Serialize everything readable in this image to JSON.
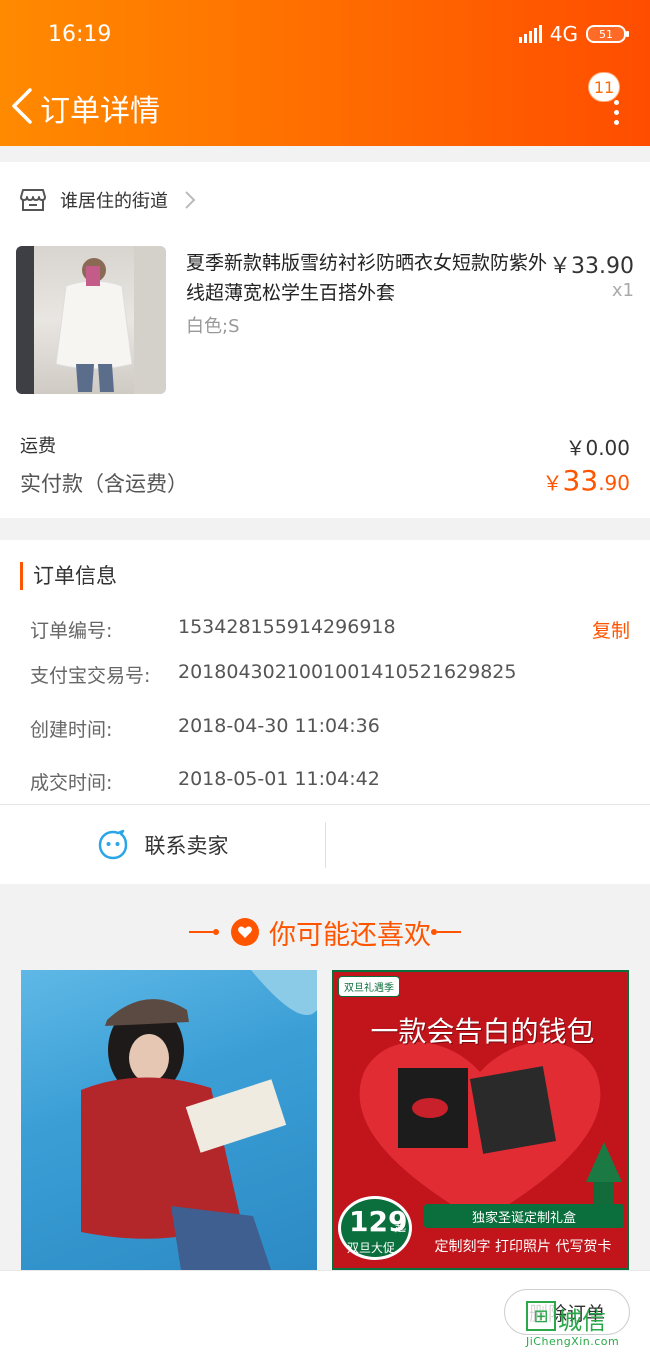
{
  "status_bar": {
    "time": "16:19",
    "network": "4G",
    "battery": "51"
  },
  "nav": {
    "title": "订单详情",
    "badge_count": "11"
  },
  "shop": {
    "name": "谁居住的街道",
    "product": {
      "title": "夏季新款韩版雪纺衬衫防晒衣女短款防紫外线超薄宽松学生百搭外套",
      "sku": "白色;S",
      "price": "￥33.90",
      "quantity": "x1"
    },
    "shipping_label": "运费",
    "shipping_value": "￥0.00",
    "paid_label": "实付款（含运费）",
    "paid_currency": "￥",
    "paid_integer": "33",
    "paid_decimal": ".90"
  },
  "order_info": {
    "title": "订单信息",
    "rows": [
      {
        "label": "订单编号:",
        "value": "153428155914296918"
      },
      {
        "label": "支付宝交易号:",
        "value": "2018043021001001410521629825"
      },
      {
        "label": "创建时间:",
        "value": "2018-04-30 11:04:36"
      },
      {
        "label": "成交时间:",
        "value": "2018-05-01 11:04:42"
      }
    ],
    "copy_label": "复制",
    "contact_label": "联系卖家"
  },
  "recommend": {
    "title": "你可能还喜欢",
    "item2": {
      "tag": "双旦礼遇季",
      "headline": "一款会告白的钱包",
      "price": "129",
      "price_suffix": "起",
      "price_label": "双旦大促",
      "banner": "独家圣诞定制礼盒",
      "subline": "定制刻字 打印照片 代写贺卡"
    }
  },
  "bottom": {
    "delete_label": "删除订单"
  },
  "watermark": {
    "text": "城信",
    "url": "JiChengXin.com"
  },
  "colors": {
    "accent": "#ff5500",
    "header_start": "#ff8a00",
    "header_end": "#ff4d00",
    "promo_green": "#0b6e3d",
    "promo_red": "#c2141b"
  }
}
